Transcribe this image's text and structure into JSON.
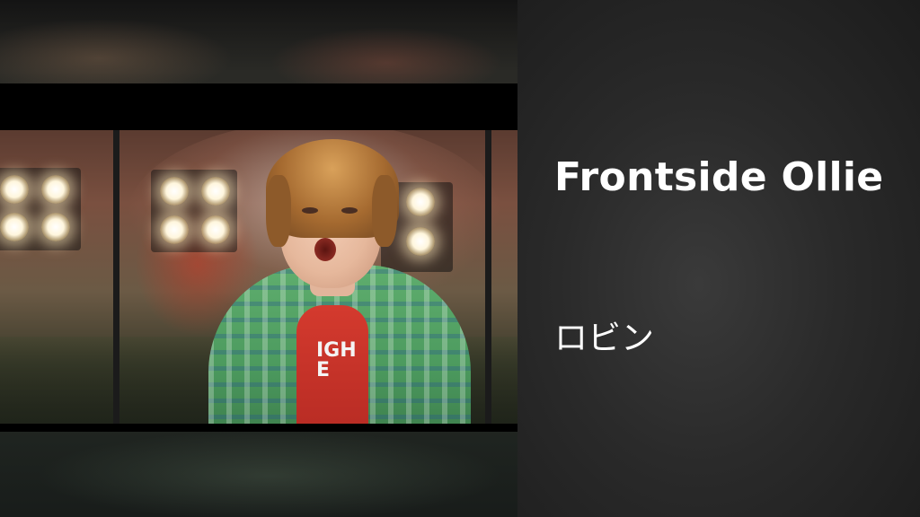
{
  "track": {
    "title": "Frontside Ollie",
    "artist": "ロビン"
  },
  "video": {
    "shirt_text": "IGH\nE"
  },
  "colors": {
    "panel_background": "#2a2a2a",
    "text": "#ffffff"
  }
}
